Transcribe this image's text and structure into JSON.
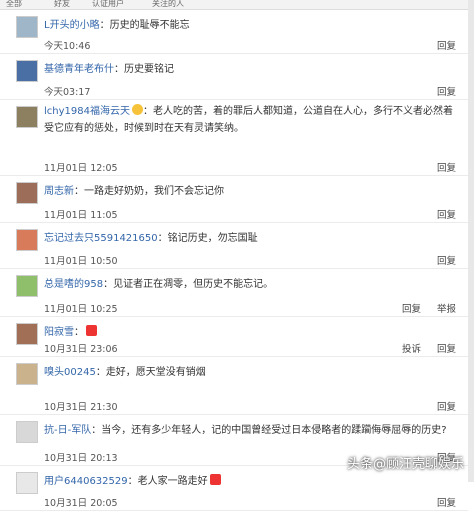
{
  "topbar": [
    "全部",
    "好友",
    "认证用户",
    "关注的人"
  ],
  "comments": [
    {
      "user": "L开头的小略",
      "text": "历史的耻辱不能忘",
      "time": "今天10:46",
      "actions": [
        "回复"
      ],
      "emoji": ""
    },
    {
      "user": "基德青年老布什",
      "text": "历史要铭记",
      "time": "今天03:17",
      "actions": [
        "回复"
      ],
      "emoji": ""
    },
    {
      "user": "lchy1984福海云天",
      "text": "老人吃的苦，着的罪后人都知道，公道自在人心，多行不义者必然着受它应有的惩处，时候到时在天有灵请笑纳。",
      "time": "11月01日 12:05",
      "actions": [
        "回复"
      ],
      "emoji": "face"
    },
    {
      "user": "周志新",
      "text": "一路走好奶奶，我们不会忘记你",
      "time": "11月01日 11:05",
      "actions": [
        "回复"
      ],
      "emoji": ""
    },
    {
      "user": "忘记过去只5591421650",
      "text": "铭记历史，勿忘国耻",
      "time": "11月01日 10:50",
      "actions": [
        "回复"
      ],
      "emoji": ""
    },
    {
      "user": "总是嗜的958",
      "text": "见证者正在凋零，但历史不能忘记。",
      "time": "11月01日 10:25",
      "actions": [
        "回复",
        "举报"
      ],
      "emoji": ""
    },
    {
      "user": "阳寂雪",
      "text": "",
      "time": "10月31日 23:06",
      "actions": [
        "投诉",
        "回复"
      ],
      "emoji": "red"
    },
    {
      "user": "嗅头00245",
      "text": "走好，愿天堂没有销烟",
      "time": "10月31日 21:30",
      "actions": [
        "回复"
      ],
      "emoji": ""
    },
    {
      "user": "抗-日-军队",
      "text": "当今，还有多少年轻人，记的中国曾经受过日本侵略者的蹂躏侮辱屈辱的历史?",
      "time": "10月31日 20:13",
      "actions": [
        "回复"
      ],
      "emoji": ""
    },
    {
      "user": "用户6440632529",
      "text": "老人家一路走好",
      "time": "10月31日 20:05",
      "actions": [
        "回复"
      ],
      "emoji": "red"
    }
  ],
  "watermark": "头条@顾汪壳聊娱乐"
}
